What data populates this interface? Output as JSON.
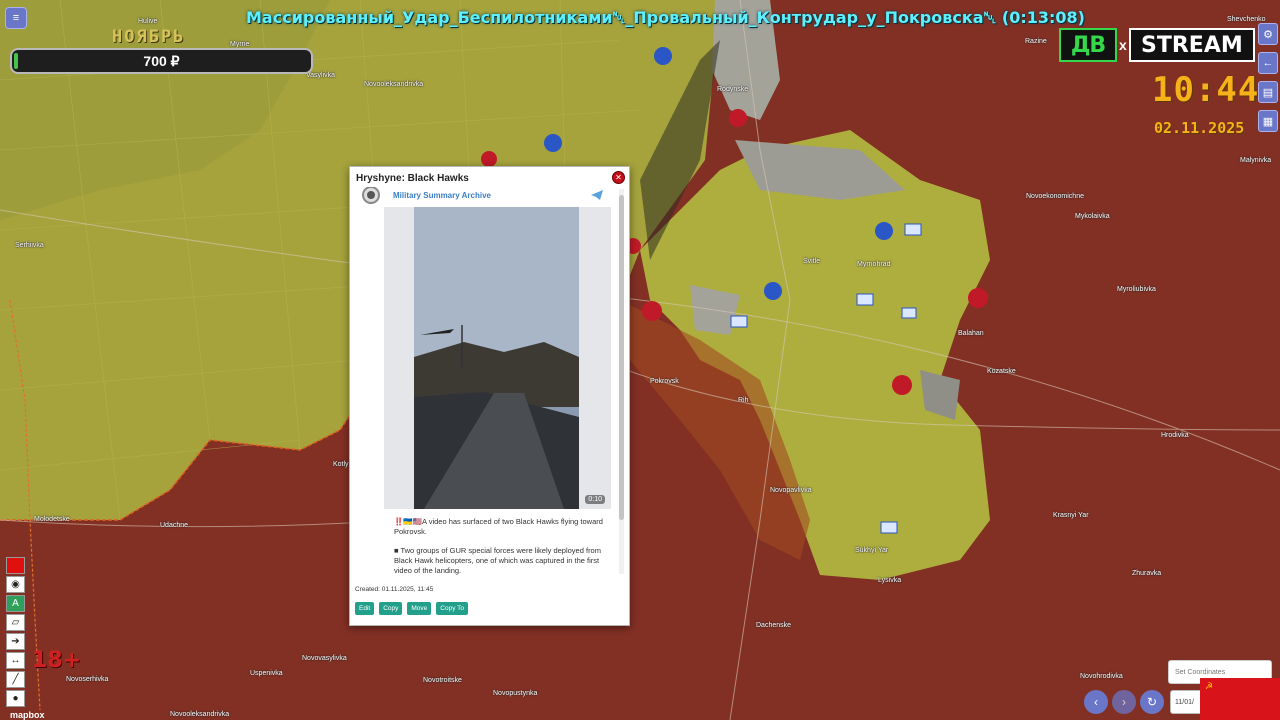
{
  "stream": {
    "title": "Массированный_Удар_Беспилотниками␀_Провальный_Контрудар_у_Покровска␀ (0:13:08)",
    "month": "НОЯБРЬ",
    "donation": "700 ₽",
    "logo_left": "ДВ",
    "logo_x": "x",
    "logo_right": "STREAM",
    "clock": "10:44",
    "date": "02.11.2025",
    "age_rating": "18+",
    "map_attribution": "mapbox"
  },
  "map": {
    "colors": {
      "occupied": "#8a3026",
      "contested": "#a85a20",
      "controlled": "#b8b845",
      "frontline": "#e06020"
    },
    "labels": [
      "Hulive",
      "Myrne",
      "Vasylivka",
      "Novooleksandrivka",
      "Rodynske",
      "Razine",
      "Shevchenko",
      "Novoekonomichne",
      "Mykolaivka",
      "Malynivka",
      "Myroliubivka",
      "Svitle",
      "Myrnohrad",
      "Balahan",
      "Serhiivka",
      "Pokrovsk",
      "Rih",
      "Kozatske",
      "Hrodivka",
      "Novopavlivka",
      "Krasnyi Yar",
      "Kotlyne",
      "Molodetske",
      "Udachne",
      "Sukhyi Yar",
      "Lysivka",
      "Zhuravka",
      "Dachenske",
      "Novovasylivka",
      "Uspenivka",
      "Novotroitske",
      "Novopustynka",
      "Novooleksandrivka",
      "Novoserhivka",
      "Novohrodivka"
    ]
  },
  "popup": {
    "title": "Hryshyne: Black Hawks",
    "close_icon": "close-icon",
    "channel": "Military Summary Archive",
    "video_duration": "0:10",
    "text_1": "‼️🇺🇦🇺🇸A video has surfaced of two Black Hawks flying toward Pokrovsk.",
    "text_2": "■ Two groups of GUR special forces were likely deployed from Black Hawk helicopters, one of which was captured in the first video of the landing.",
    "created": "Created: 01.11.2025, 11:45",
    "actions": {
      "edit": "Edit",
      "copy": "Copy",
      "move": "Move",
      "copy_to": "Copy To"
    }
  },
  "controls": {
    "set_coordinates_placeholder": "Set Coordinates",
    "date_value": "11/01/",
    "prev_icon": "chevron-left-icon",
    "next_icon": "chevron-right-icon",
    "refresh_icon": "refresh-icon",
    "flag_icon": "ussr-flag-icon"
  }
}
